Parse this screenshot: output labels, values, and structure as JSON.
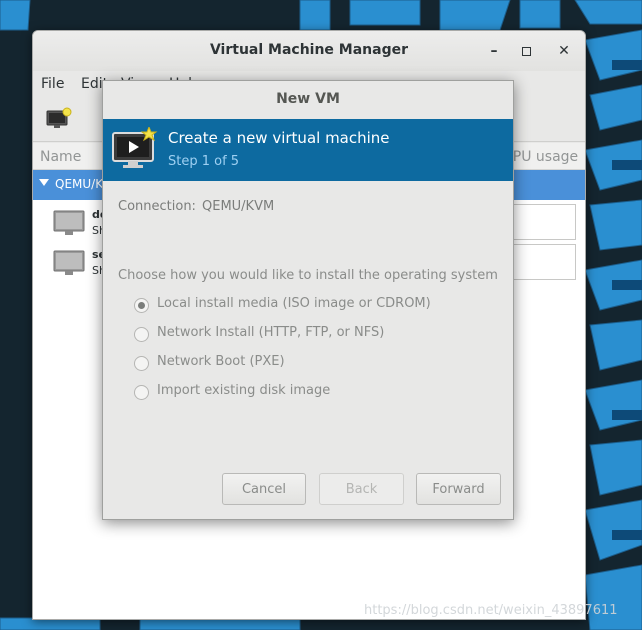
{
  "main_window": {
    "title": "Virtual Machine Manager",
    "menu": [
      "File",
      "Edit",
      "View",
      "Help"
    ],
    "columns": {
      "name": "Name",
      "cpu": "CPU usage"
    },
    "connection_group": "QEMU/KVM",
    "vms": [
      {
        "name": "de",
        "status": "Sh"
      },
      {
        "name": "se",
        "status": "Sh"
      }
    ]
  },
  "dialog": {
    "title": "New VM",
    "header_title": "Create a new virtual machine",
    "header_step": "Step 1 of 5",
    "connection_label": "Connection:",
    "connection_value": "QEMU/KVM",
    "choose_label": "Choose how you would like to install the operating system",
    "options": [
      {
        "label": "Local install media (ISO image or CDROM)",
        "selected": true
      },
      {
        "label": "Network Install (HTTP, FTP, or NFS)",
        "selected": false
      },
      {
        "label": "Network Boot (PXE)",
        "selected": false
      },
      {
        "label": "Import existing disk image",
        "selected": false
      }
    ],
    "buttons": {
      "cancel": "Cancel",
      "back": "Back",
      "forward": "Forward"
    }
  },
  "watermark": "https://blog.csdn.net/weixin_43897611",
  "colors": {
    "accent": "#4a90d9",
    "header": "#0d6aa0",
    "desktop": "#14252f",
    "maze": "#2a8fd0"
  },
  "icons": {
    "new_vm": "monitor-with-star-icon",
    "vm": "monitor-icon"
  }
}
